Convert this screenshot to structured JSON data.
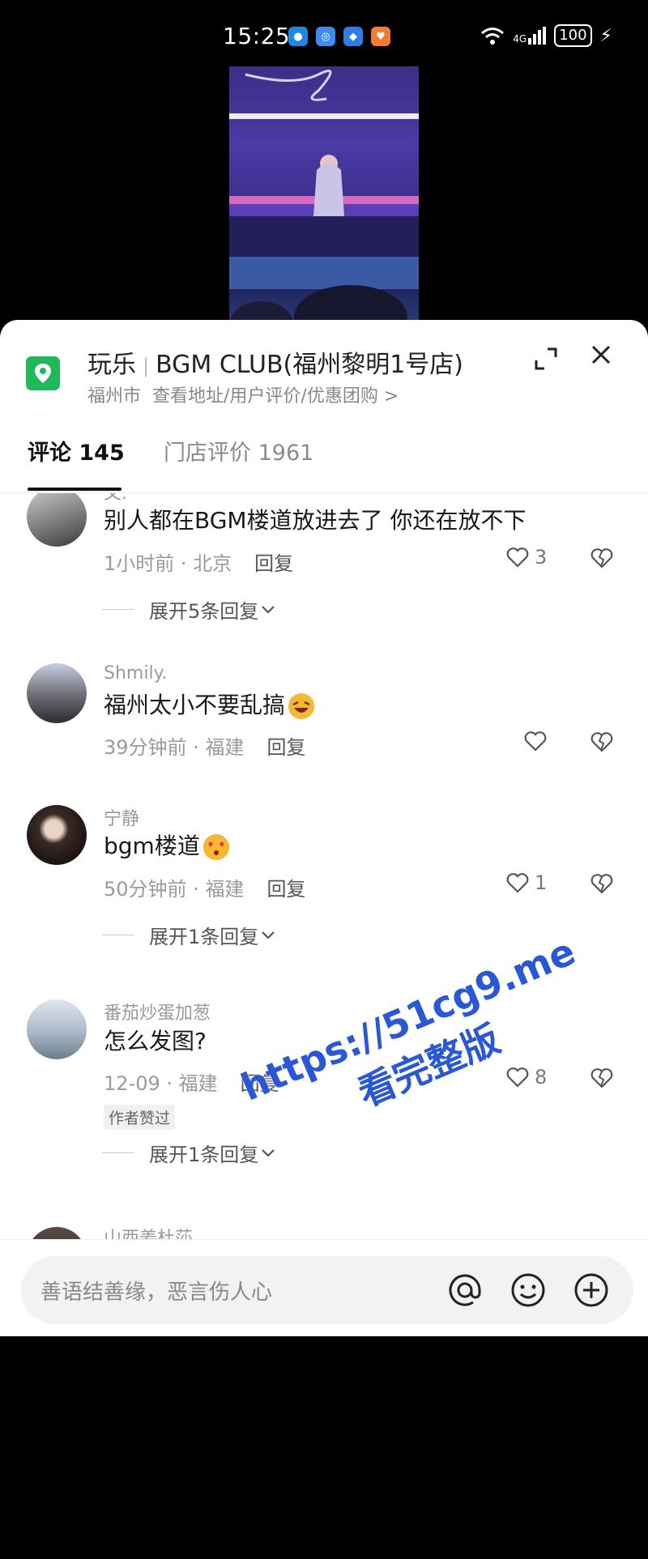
{
  "status_bar": {
    "time": "15:25",
    "network": "4G",
    "battery": "100"
  },
  "location": {
    "category": "玩乐",
    "name": "BGM CLUB(福州黎明1号店)",
    "city": "福州市",
    "link": "查看地址/用户评价/优惠团购 >"
  },
  "tabs": [
    {
      "label": "评论 145"
    },
    {
      "label": "门店评价 1961"
    }
  ],
  "comments": [
    {
      "name": "文.",
      "text": "别人都在BGM楼道放进去了 你还在放不下",
      "time": "1小时前 · 北京",
      "reply": "回复",
      "likes": "3",
      "expand": "展开5条回复"
    },
    {
      "name": "Shmily.",
      "text": "福州太小不要乱搞",
      "time": "39分钟前 · 福建",
      "reply": "回复",
      "likes": ""
    },
    {
      "name": "宁静",
      "text": "bgm楼道",
      "time": "50分钟前 · 福建",
      "reply": "回复",
      "likes": "1",
      "expand": "展开1条回复"
    },
    {
      "name": "番茄炒蛋加葱",
      "text": "怎么发图?",
      "time": "12-09 · 福建",
      "reply": "回复",
      "likes": "8",
      "badge": "作者赞过",
      "expand": "展开1条回复"
    },
    {
      "name": "山西姜杜莎"
    }
  ],
  "input": {
    "placeholder": "善语结善缘，恶言伤人心"
  },
  "watermark": {
    "url": "https://51cg9.me",
    "text": "看完整版"
  },
  "colors": {
    "accent": "#1fb85b",
    "watermark": "#2a57d6"
  }
}
